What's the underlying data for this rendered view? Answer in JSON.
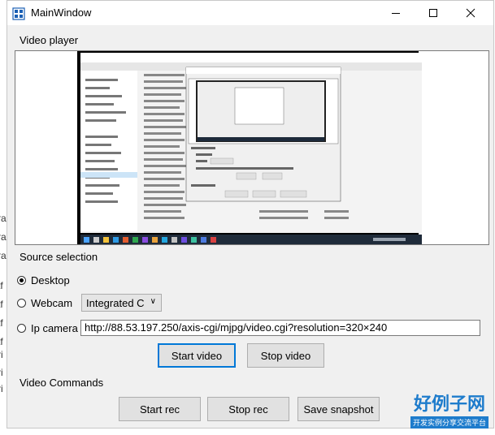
{
  "window": {
    "title": "MainWindow"
  },
  "video_player": {
    "label": "Video player"
  },
  "source": {
    "label": "Source selection",
    "options": [
      {
        "label": "Desktop",
        "checked": true
      },
      {
        "label": "Webcam",
        "checked": false
      },
      {
        "label": "Ip camera",
        "checked": false
      }
    ],
    "webcam_selected": "Integrated C",
    "ip_url": "http://88.53.197.250/axis-cgi/mjpg/video.cgi?resolution=320×240"
  },
  "buttons": {
    "start_video": "Start video",
    "stop_video": "Stop video"
  },
  "commands": {
    "label": "Video Commands",
    "start_rec": "Start rec",
    "stop_rec": "Stop rec",
    "save_snapshot": "Save snapshot"
  },
  "watermark": {
    "main": "好例子网",
    "sub": "开发实例分享交流平台"
  },
  "colors": {
    "focus": "#0078d7",
    "watermark": "#1e7ccc"
  }
}
